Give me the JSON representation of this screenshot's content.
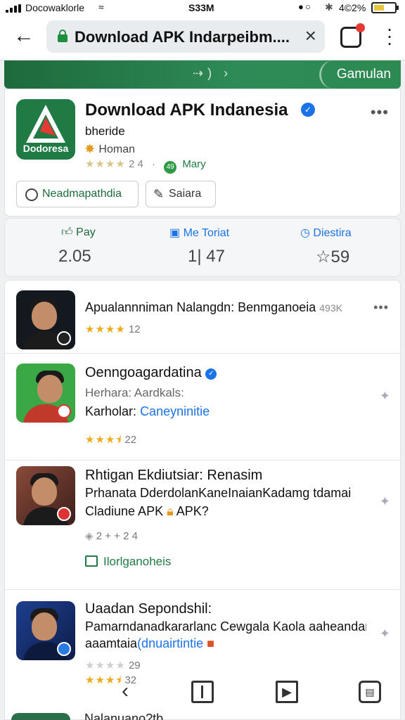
{
  "status_bar": {
    "carrier": "Docowaklorle",
    "time": "S33M",
    "battery_text": "4©2%",
    "battery_level": 0.5
  },
  "browser": {
    "url": "Download APK Indarpeibm....",
    "tab_count": ""
  },
  "banner": {
    "more_label": "Gamulan"
  },
  "app": {
    "title": "Download APK Indanesia",
    "logo_text": "Dodoresa",
    "developer": "bheride",
    "category": "Homan",
    "rating_value": "2 4",
    "badge_label": "Mary",
    "badge_code": "49",
    "buttons": {
      "primary": "Neadmapathdia",
      "secondary": "Saiara"
    }
  },
  "stats": [
    {
      "label": "Pay",
      "value": "2.05"
    },
    {
      "label": "Me Toriat",
      "value": "1| 47"
    },
    {
      "label": "Diestira",
      "value": "59"
    }
  ],
  "list": [
    {
      "title": "Apualannniman Nalangdn: Benmganoeia",
      "size": "493K",
      "rating": "12",
      "stars": 4
    },
    {
      "title": "Oenngoagardatina",
      "line2": "Herhara: Aardkals:",
      "line3_prefix": "Karholar:",
      "line3_link": "Caneyninitie",
      "rating": "22",
      "stars": 3.5
    },
    {
      "title": "Rhtigan Ekdiutsiar: Renasim",
      "line2": "Prhanata DderdolanKaneInaianKadamg tdamai",
      "line3": "Cladiune APK",
      "line3_suffix": "APK?",
      "meta": "2 + + 2 4",
      "install_label": "Ilorlganoheis"
    },
    {
      "title": "Uaadan Sepondshil:",
      "line2": "Pamarndanadkararlanc Cewgala Kaola aaheandan",
      "line3_prefix": "aaamtaia",
      "line3_link": "(dnuairtintie",
      "rating_a": "29",
      "rating_b": "32",
      "stars": 3.5
    },
    {
      "title": "Nalanuano?tb"
    }
  ]
}
